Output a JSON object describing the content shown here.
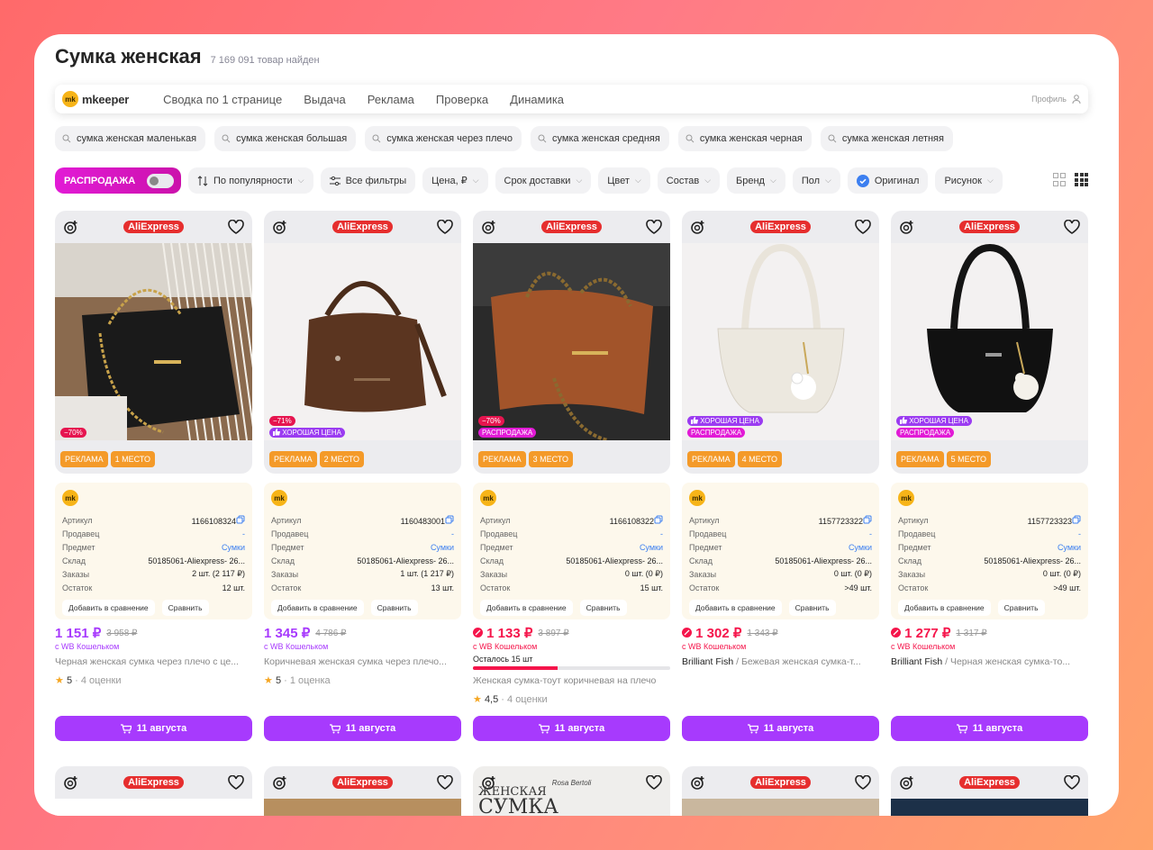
{
  "header": {
    "title": "Сумка женская",
    "count": "7 169 091 товар найден"
  },
  "mkeeper": {
    "logo_mark": "mk",
    "logo_name": "mkeeper",
    "nav": [
      "Сводка по 1 странице",
      "Выдача",
      "Реклама",
      "Проверка",
      "Динамика"
    ],
    "profile": "Профиль"
  },
  "suggestions": [
    "сумка женская маленькая",
    "сумка женская большая",
    "сумка женская через плечо",
    "сумка женская средняя",
    "сумка женская черная",
    "сумка женская летняя"
  ],
  "filters": {
    "sale_label": "РАСПРОДАЖА",
    "sort": "По популярности",
    "all_filters": "Все фильтры",
    "price": "Цена, ₽",
    "delivery": "Срок доставки",
    "color": "Цвет",
    "composition": "Состав",
    "brand": "Бренд",
    "gender": "Пол",
    "original": "Оригинал",
    "pattern": "Рисунок"
  },
  "labels": {
    "ae": "AliExpress",
    "ad": "РЕКЛАМА",
    "article": "Артикул",
    "seller": "Продавец",
    "subject": "Предмет",
    "warehouse": "Склад",
    "orders": "Заказы",
    "stock": "Остаток",
    "add_compare": "Добавить в сравнение",
    "compare": "Сравнить",
    "wallet": "с WB Кошельком"
  },
  "colors": {
    "accent": "#a73afd",
    "sale": "#e21bd6",
    "price_red": "#f5154b",
    "ad": "#f49a29",
    "ae": "#e62e2e"
  },
  "cards": [
    {
      "disc": "−70%",
      "good": "",
      "saletag": "",
      "place": "1 МЕСТО",
      "article": "1166108324",
      "seller": "-",
      "subject": "Сумки",
      "warehouse": "50185061-Aliexpress- 26...",
      "orders": "2 шт. (2 117 ₽)",
      "stock": "12 шт.",
      "price": "1 151 ₽",
      "old": "3 958 ₽",
      "brand": "",
      "name": "Черная женская сумка через плечо с це...",
      "rating": "5",
      "reviews": "· 4 оценки",
      "cart": "11 августа",
      "stock_left": ""
    },
    {
      "disc": "−71%",
      "good": "ХОРОШАЯ ЦЕНА",
      "saletag": "",
      "place": "2 МЕСТО",
      "article": "1160483001",
      "seller": "-",
      "subject": "Сумки",
      "warehouse": "50185061-Aliexpress- 26...",
      "orders": "1 шт. (1 217 ₽)",
      "stock": "13 шт.",
      "price": "1 345 ₽",
      "old": "4 786 ₽",
      "brand": "",
      "name": "Коричневая женская сумка через плечо...",
      "rating": "5",
      "reviews": "· 1 оценка",
      "cart": "11 августа",
      "stock_left": ""
    },
    {
      "disc": "−70%",
      "good": "",
      "saletag": "РАСПРОДАЖА",
      "place": "3 МЕСТО",
      "article": "1166108322",
      "seller": "-",
      "subject": "Сумки",
      "warehouse": "50185061-Aliexpress- 26...",
      "orders": "0 шт. (0 ₽)",
      "stock": "15 шт.",
      "price": "1 133 ₽",
      "old": "3 897 ₽",
      "brand": "",
      "name": "Женская сумка-тоут коричневая на плечо",
      "rating": "4,5",
      "reviews": "· 4 оценки",
      "cart": "11 августа",
      "stock_left": "Осталось 15 шт",
      "stock_fraction": 0.43
    },
    {
      "disc": "",
      "good": "ХОРОШАЯ ЦЕНА",
      "saletag": "РАСПРОДАЖА",
      "place": "4 МЕСТО",
      "article": "1157723322",
      "seller": "-",
      "subject": "Сумки",
      "warehouse": "50185061-Aliexpress- 26...",
      "orders": "0 шт. (0 ₽)",
      "stock": ">49 шт.",
      "price": "1 302 ₽",
      "old": "1 343 ₽",
      "brand": "Brilliant Fish",
      "name": " / Бежевая женская сумка-т...",
      "rating": "",
      "reviews": "",
      "cart": "11 августа",
      "stock_left": ""
    },
    {
      "disc": "",
      "good": "ХОРОШАЯ ЦЕНА",
      "saletag": "РАСПРОДАЖА",
      "place": "5 МЕСТО",
      "article": "1157723323",
      "seller": "-",
      "subject": "Сумки",
      "warehouse": "50185061-Aliexpress- 26...",
      "orders": "0 шт. (0 ₽)",
      "stock": ">49 шт.",
      "price": "1 277 ₽",
      "old": "1 317 ₽",
      "brand": "Brilliant Fish",
      "name": " / Черная женская сумка-то...",
      "rating": "",
      "reviews": "",
      "cart": "11 августа",
      "stock_left": ""
    }
  ],
  "row2": {
    "banner_line1": "ЖЕНСКАЯ",
    "banner_line2": "СУМКА",
    "banner_brand": "Rosa Bertoli"
  }
}
